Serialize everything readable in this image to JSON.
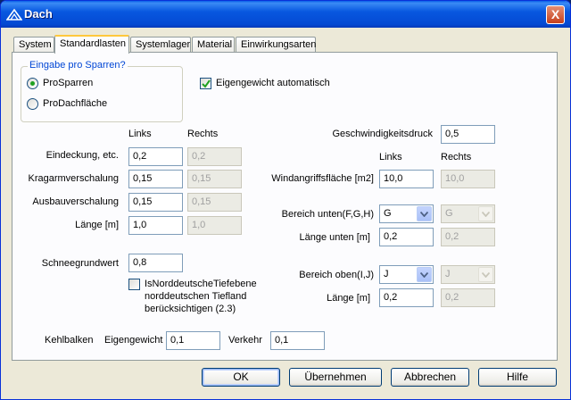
{
  "window": {
    "title": "Dach",
    "close_label": "X"
  },
  "tabs": [
    "System",
    "Standardlasten",
    "Systemlager",
    "Material",
    "Einwirkungsarten"
  ],
  "sparren_group": {
    "legend": "Eingabe pro Sparren?",
    "options": [
      "ProSparren",
      "ProDachfläche"
    ],
    "selected": "ProSparren"
  },
  "eigengewicht": {
    "label": "Eigengewicht automatisch",
    "checked": true
  },
  "left": {
    "header_links": "Links",
    "header_rechts": "Rechts",
    "rows": [
      {
        "label": "Eindeckung, etc.",
        "links": "0,2",
        "rechts": "0,2"
      },
      {
        "label": "Kragarmverschalung",
        "links": "0,15",
        "rechts": "0,15"
      },
      {
        "label": "Ausbauverschalung",
        "links": "0,15",
        "rechts": "0,15"
      },
      {
        "label": "Länge [m]",
        "links": "1,0",
        "rechts": "1,0"
      }
    ],
    "schnee_label": "Schneegrundwert",
    "schnee_value": "0,8",
    "tiefebene_lines": [
      "IsNorddeutscheTiefebene",
      "norddeutschen Tiefland",
      "berücksichtigen (2.3)"
    ],
    "tiefebene_checked": false
  },
  "right": {
    "geschw_label": "Geschwindigkeitsdruck",
    "geschw_value": "0,5",
    "header_links": "Links",
    "header_rechts": "Rechts",
    "wind_label": "Windangriffsfläche [m2]",
    "wind_links": "10,0",
    "wind_rechts": "10,0",
    "bereich_unten_label": "Bereich unten(F,G,H)",
    "bereich_unten_links": "G",
    "bereich_unten_rechts": "G",
    "laenge_unten_label": "Länge unten [m]",
    "laenge_unten_links": "0,2",
    "laenge_unten_rechts": "0,2",
    "bereich_oben_label": "Bereich oben(I,J)",
    "bereich_oben_links": "J",
    "bereich_oben_rechts": "J",
    "laenge_label": "Länge  [m]",
    "laenge_links": "0,2",
    "laenge_rechts": "0,2"
  },
  "kehlbalken": {
    "label": "Kehlbalken",
    "eigengewicht_label": "Eigengewicht",
    "eigengewicht_value": "0,1",
    "verkehr_label": "Verkehr",
    "verkehr_value": "0,1"
  },
  "buttons": {
    "ok": "OK",
    "uebernehmen": "Übernehmen",
    "abbrechen": "Abbrechen",
    "hilfe": "Hilfe"
  }
}
